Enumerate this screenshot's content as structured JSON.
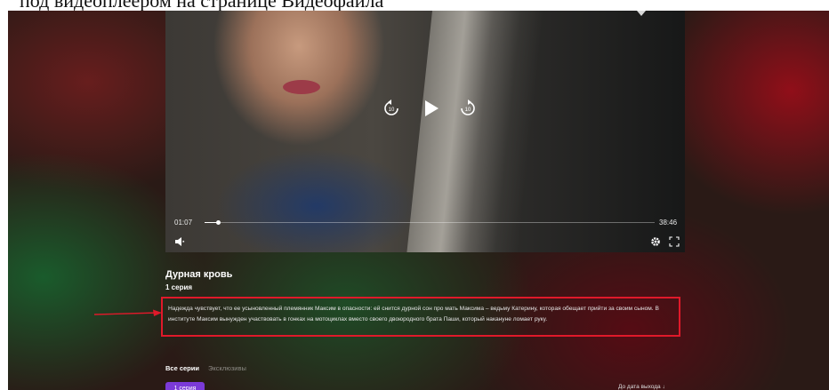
{
  "caption": {
    "text": "под видеоплеером на странице Видеофайла"
  },
  "player": {
    "current_time": "01:07",
    "total_time": "38:46",
    "progress": 0.029,
    "rewind_seconds": "10",
    "forward_seconds": "10"
  },
  "info": {
    "title": "Дурная кровь",
    "episode": "1 серия",
    "description": "Надежда чувствует, что ее усыновленный племянник Максим в опасности: ей снится дурной сон про мать Максима – ведьму Катерину, которая обещает прийти за своим сыном. В институте Максим вынужден участвовать в гонках на мотоциклах вместо своего двоюродного брата Паши, который накануне ломает руку."
  },
  "tabs": [
    {
      "label": "Все серии",
      "active": true
    },
    {
      "label": "Эксклюзивы",
      "active": false
    }
  ],
  "episode_button": {
    "label": "1 серия"
  },
  "to_end": {
    "label": "До дата выхода"
  },
  "colors": {
    "highlight_border": "#e0192a",
    "accent": "#7b3ad8"
  },
  "icons": [
    "chevron-down-icon",
    "rewind-10-icon",
    "play-icon",
    "forward-10-icon",
    "volume-icon",
    "gear-icon",
    "fullscreen-icon",
    "red-arrow-icon",
    "arrow-down-icon"
  ]
}
